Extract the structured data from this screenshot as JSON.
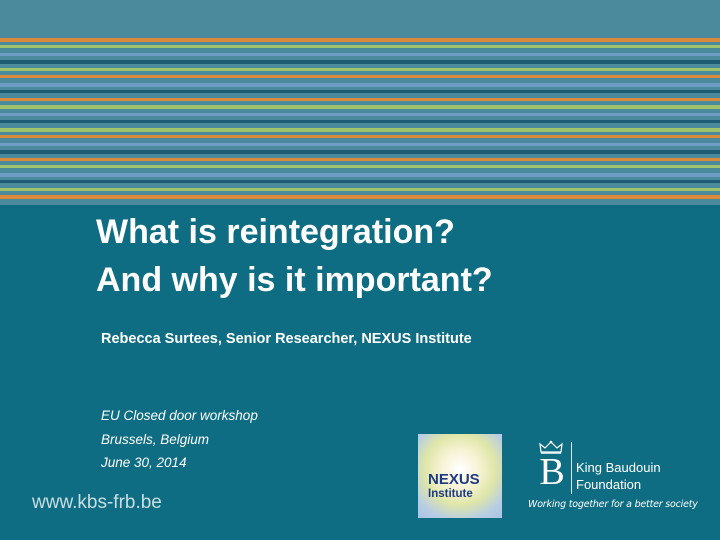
{
  "title": {
    "line1": "What is reintegration?",
    "line2": "And why is it important?"
  },
  "subtitle": "Rebecca Surtees, Senior Researcher, NEXUS Institute",
  "event": {
    "line1": "EU Closed door workshop",
    "line2": "Brussels, Belgium",
    "line3": "June 30,  2014"
  },
  "footer_url": "www.kbs-frb.be",
  "nexus_logo": {
    "name": "NEXUS",
    "sub": "Institute"
  },
  "kbf_logo": {
    "name_line1": "King Baudouin",
    "name_line2": "Foundation",
    "tagline": "Working together for a better society"
  },
  "colors": {
    "background": "#0e6d82",
    "stripe_orange": "#d98a3a",
    "stripe_green": "#9ec36a",
    "stripe_blue": "#6f9cc4",
    "stripe_dark": "#1f5b73"
  }
}
